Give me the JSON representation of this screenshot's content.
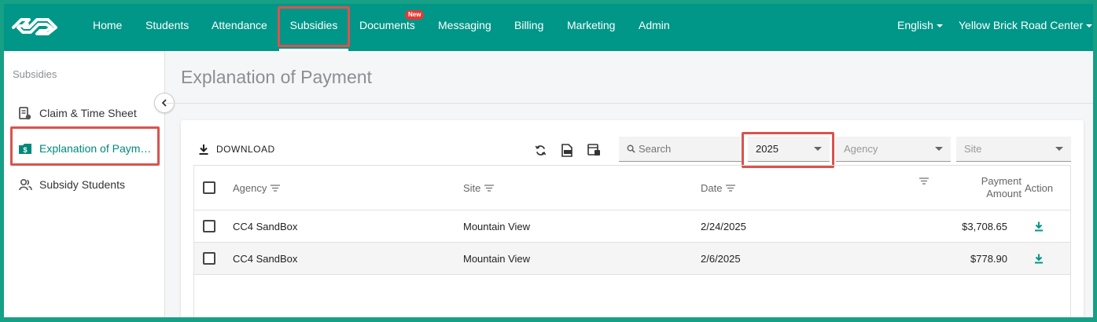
{
  "nav": {
    "items": [
      {
        "label": "Home"
      },
      {
        "label": "Students"
      },
      {
        "label": "Attendance"
      },
      {
        "label": "Subsidies"
      },
      {
        "label": "Documents",
        "badge": "New"
      },
      {
        "label": "Messaging"
      },
      {
        "label": "Billing"
      },
      {
        "label": "Marketing"
      },
      {
        "label": "Admin"
      }
    ],
    "language": "English",
    "center": "Yellow Brick Road Center",
    "active": "Subsidies"
  },
  "sidebar": {
    "heading": "Subsidies",
    "items": [
      {
        "label": "Claim & Time Sheet",
        "icon": "receipt-icon"
      },
      {
        "label": "Explanation of Paym…",
        "icon": "money-folder-icon",
        "active": true
      },
      {
        "label": "Subsidy Students",
        "icon": "people-icon"
      }
    ]
  },
  "page": {
    "title": "Explanation of Payment"
  },
  "toolbar": {
    "download_label": "DOWNLOAD",
    "search_placeholder": "Search",
    "year_value": "2025",
    "agency_placeholder": "Agency",
    "site_placeholder": "Site"
  },
  "table": {
    "headers": {
      "agency": "Agency",
      "site": "Site",
      "date": "Date",
      "amount_line1": "Payment",
      "amount_line2": "Amount",
      "action": "Action"
    },
    "rows": [
      {
        "agency": "CC4 SandBox",
        "site": "Mountain View",
        "date": "2/24/2025",
        "amount": "$3,708.65"
      },
      {
        "agency": "CC4 SandBox",
        "site": "Mountain View",
        "date": "2/6/2025",
        "amount": "$778.90"
      }
    ]
  },
  "colors": {
    "primary": "#009688",
    "highlight": "#d9534f",
    "active_text": "#00897b"
  }
}
